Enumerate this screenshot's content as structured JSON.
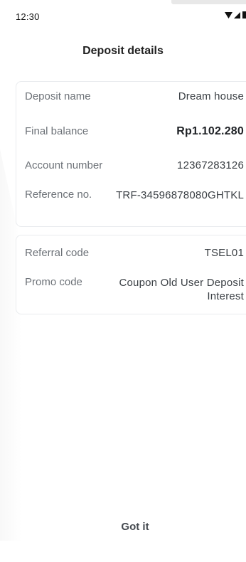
{
  "status_bar": {
    "time": "12:30",
    "icons": [
      "wifi-icon",
      "signal-icon",
      "battery-icon"
    ]
  },
  "header": {
    "title": "Deposit details"
  },
  "deposit_card": {
    "rows": [
      {
        "label": "Deposit name",
        "value": "Dream house"
      },
      {
        "label": "Final balance",
        "value": "Rp1.102.280"
      },
      {
        "label": "Account number",
        "value": "12367283126"
      },
      {
        "label": "Reference no.",
        "value": "TRF-34596878080GHTKL"
      }
    ]
  },
  "promo_card": {
    "rows": [
      {
        "label": "Referral code",
        "value": "TSEL01"
      },
      {
        "label": "Promo code",
        "value": "Coupon Old User Deposit Interest"
      }
    ]
  },
  "footer": {
    "got_it_label": "Got it"
  }
}
